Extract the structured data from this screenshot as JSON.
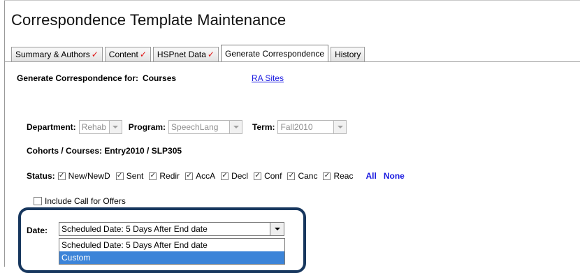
{
  "page": {
    "title": "Correspondence Template Maintenance"
  },
  "tabs": [
    {
      "label": "Summary & Authors",
      "checked": true
    },
    {
      "label": "Content",
      "checked": true
    },
    {
      "label": "HSPnet Data",
      "checked": true
    },
    {
      "label": "Generate Correspondence",
      "checked": false,
      "active": true
    },
    {
      "label": "History",
      "checked": false
    }
  ],
  "check_mark": "✓",
  "generate": {
    "label": "Generate Correspondence for:",
    "value": "Courses",
    "link": "RA Sites"
  },
  "filters": {
    "department": {
      "label": "Department:",
      "value": "Rehab"
    },
    "program": {
      "label": "Program:",
      "value": "SpeechLang"
    },
    "term": {
      "label": "Term:",
      "value": "Fall2010"
    }
  },
  "cohorts": {
    "text": "Cohorts / Courses: Entry2010 / SLP305"
  },
  "status": {
    "label": "Status:",
    "options": [
      {
        "label": "New/NewD",
        "checked": true
      },
      {
        "label": "Sent",
        "checked": true
      },
      {
        "label": "Redir",
        "checked": true
      },
      {
        "label": "AccA",
        "checked": true
      },
      {
        "label": "Decl",
        "checked": true
      },
      {
        "label": "Conf",
        "checked": true
      },
      {
        "label": "Canc",
        "checked": true
      },
      {
        "label": "Reac",
        "checked": true
      }
    ],
    "all_label": "All",
    "none_label": "None"
  },
  "include_offers": {
    "label": "Include Call for Offers",
    "checked": false
  },
  "date": {
    "label": "Date:",
    "selected": "Scheduled Date: 5 Days After End date",
    "options": [
      "Scheduled Date: 5 Days After End date",
      "Custom"
    ],
    "highlighted_option": "Custom"
  },
  "colors": {
    "link": "#1a1ae0",
    "check": "#e01010",
    "highlight_border": "#17375e",
    "selected_option": "#3c84d8"
  }
}
